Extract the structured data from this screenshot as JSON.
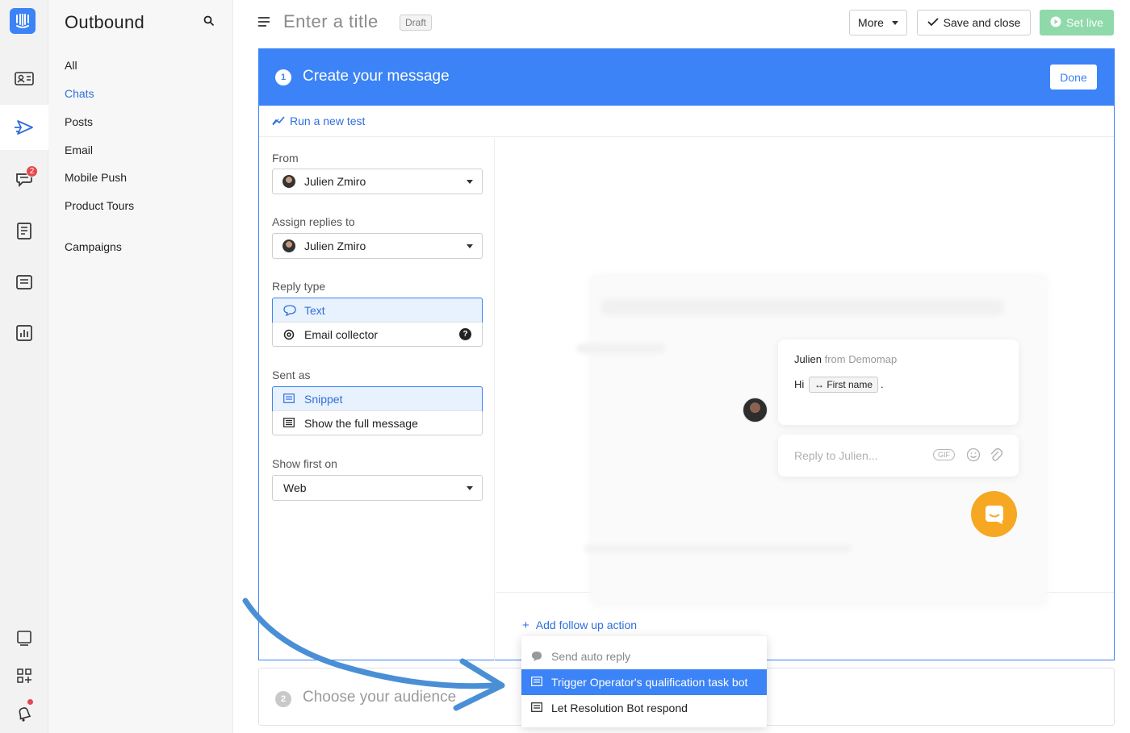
{
  "app": {
    "section_title": "Outbound",
    "nav_links": [
      "All",
      "Chats",
      "Posts",
      "Email",
      "Mobile Push",
      "Product Tours",
      "Campaigns"
    ],
    "active_nav": "Chats",
    "notification_count": "2"
  },
  "header": {
    "title_placeholder": "Enter a title",
    "status": "Draft",
    "more_label": "More",
    "save_close_label": "Save and close",
    "set_live_label": "Set live"
  },
  "step1": {
    "number": "1",
    "title": "Create your message",
    "done_label": "Done",
    "run_test_label": "Run a new test",
    "from_label": "From",
    "from_value": "Julien Zmiro",
    "assign_label": "Assign replies to",
    "assign_value": "Julien Zmiro",
    "reply_type_label": "Reply type",
    "reply_types": [
      "Text",
      "Email collector"
    ],
    "reply_type_help": "?",
    "sent_as_label": "Sent as",
    "sent_as_options": [
      "Snippet",
      "Show the full message"
    ],
    "show_first_label": "Show first on",
    "show_first_value": "Web"
  },
  "preview": {
    "sender_name": "Julien",
    "sender_from": "from Demomap",
    "greeting": "Hi",
    "attribute_chip": "First name",
    "trailing": ".",
    "reply_placeholder": "Reply to Julien...",
    "gif_label": "GIF"
  },
  "followup": {
    "add_label": "Add follow up action",
    "plus": "+",
    "options": [
      "Send auto reply",
      "Trigger Operator's qualification task bot",
      "Let Resolution Bot respond"
    ]
  },
  "step2": {
    "number": "2",
    "title": "Choose your audience"
  },
  "colors": {
    "accent": "#3b83f6",
    "set_live": "#8fd9ab",
    "launcher": "#f6a822",
    "annotation_arrow": "#4a8fd6"
  },
  "icons": [
    "logo-icon",
    "contacts-icon",
    "outbound-icon",
    "inbox-icon",
    "articles-icon",
    "messages-icon",
    "reports-icon",
    "search-icon",
    "menu-icon",
    "check-icon",
    "play-icon",
    "chart-icon"
  ]
}
